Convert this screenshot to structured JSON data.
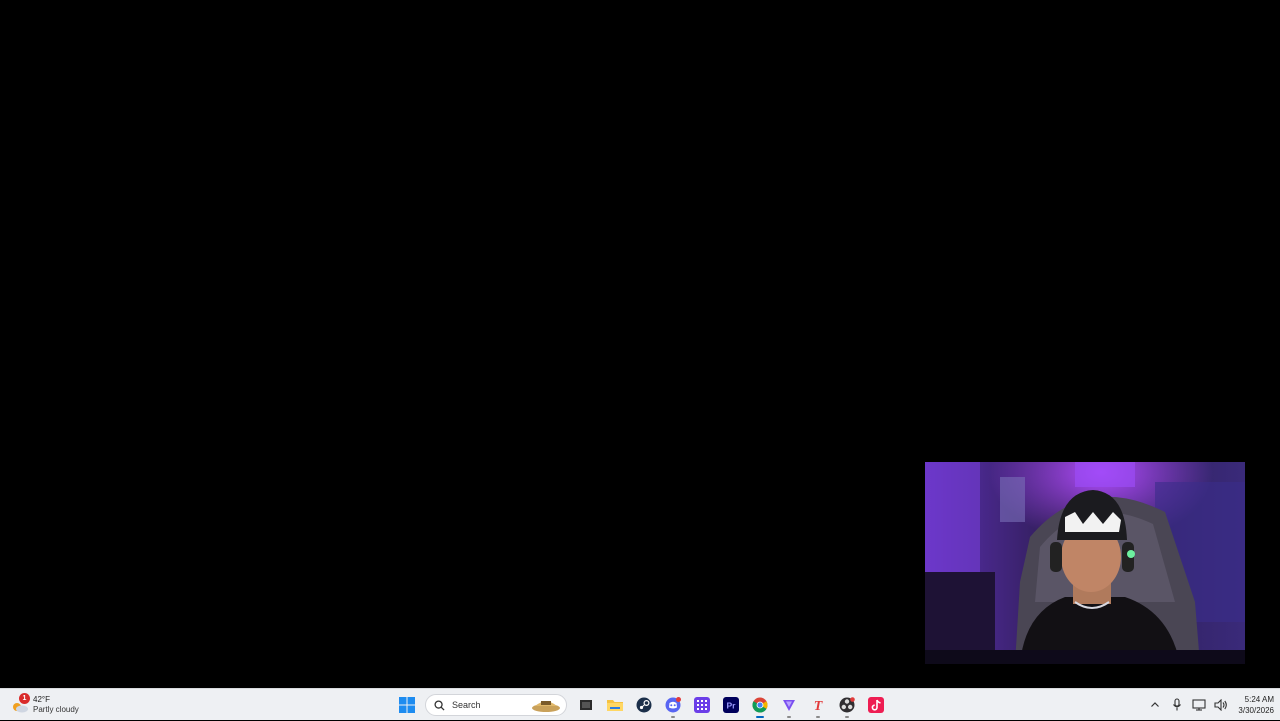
{
  "weather": {
    "temperature": "42°F",
    "condition": "Partly cloudy",
    "badge_count": "1",
    "icon": "partly-cloudy-icon"
  },
  "taskbar": {
    "search_placeholder": "Search",
    "apps": [
      {
        "name": "start",
        "icon": "windows-logo-icon"
      },
      {
        "name": "task-view",
        "icon": "task-view-icon"
      },
      {
        "name": "file-explorer",
        "icon": "folder-icon"
      },
      {
        "name": "steam",
        "icon": "steam-icon"
      },
      {
        "name": "discord",
        "icon": "discord-icon"
      },
      {
        "name": "app-grid",
        "icon": "grid-app-icon"
      },
      {
        "name": "premiere-pro",
        "icon": "premiere-pro-icon",
        "label": "Pr"
      },
      {
        "name": "chrome",
        "icon": "chrome-icon"
      },
      {
        "name": "streamlabs",
        "icon": "streamlabs-icon"
      },
      {
        "name": "tiktok-live-studio",
        "icon": "text-t-icon",
        "label": "T"
      },
      {
        "name": "obs",
        "icon": "obs-icon"
      },
      {
        "name": "tiktok",
        "icon": "tiktok-icon"
      }
    ]
  },
  "tray": {
    "icons": [
      "chevron-up-icon",
      "microphone-icon",
      "network-icon",
      "volume-icon"
    ]
  },
  "clock": {
    "time": "5:24 AM",
    "date": "3/30/2026"
  },
  "colors": {
    "desktop": "#000000",
    "taskbar": "#eef0f3",
    "accent": "#0067c0"
  }
}
